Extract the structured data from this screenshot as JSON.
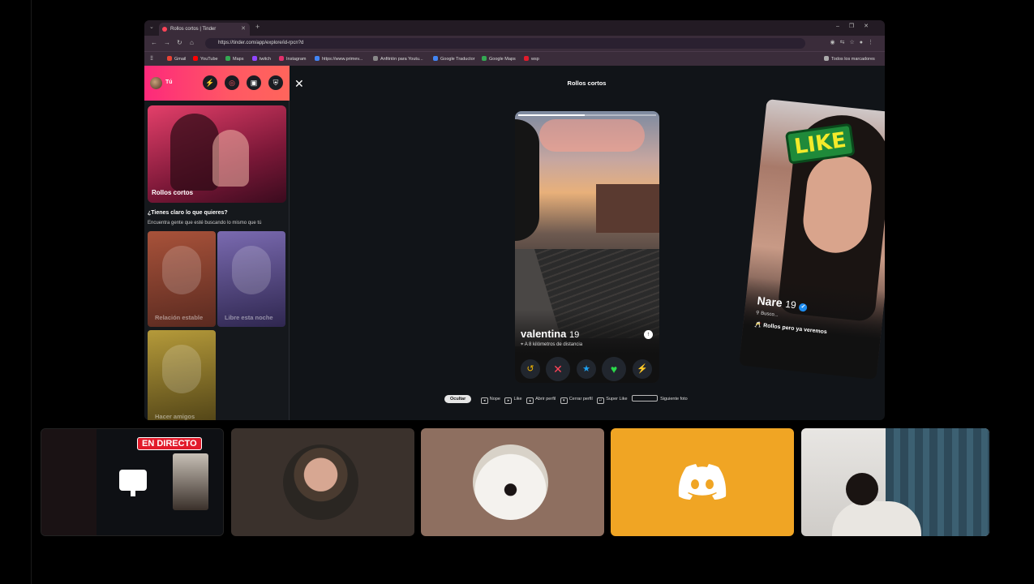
{
  "browser": {
    "tab_title": "Rollos cortos | Tinder",
    "url": "https://tinder.com/app/explore/id-rpcn?d",
    "url_prefix": "https://",
    "bookmarks": [
      "Gmail",
      "YouTube",
      "Maps",
      "twitch",
      "Instagram",
      "https://www.primev...",
      "Anfitrión para Youtu...",
      "Google Traductor",
      "Google Maps",
      "wsp"
    ],
    "all_bookmarks": "Todos los marcadores"
  },
  "sidebar": {
    "user_name": "Tú",
    "featured_card": "Rollos cortos",
    "question": "¿Tienes claro lo que quieres?",
    "question_sub": "Encuentra gente que esté buscando lo mismo que tú",
    "cards": [
      "Relación estable",
      "Libre esta noche",
      "Hacer amigos"
    ]
  },
  "main": {
    "title": "Rollos cortos",
    "current_profile": {
      "name": "valentina",
      "age": "19",
      "distance": "A 8 kilómetros de distancia"
    },
    "next_profile": {
      "name": "Nare",
      "age": "19",
      "looking": "Busco...",
      "tag": "Rollos pero ya veremos",
      "badge": "LIKE"
    },
    "hints": {
      "hide": "Ocultar",
      "nope": "Nope",
      "like": "Like",
      "open": "Abrir perfil",
      "close": "Cerrar perfil",
      "superlike": "Super Like",
      "next_photo": "Siguiente foto"
    }
  },
  "participants": {
    "live_badge": "EN DIRECTO"
  },
  "colors": {
    "tinder_pink": "#fd297b",
    "tinder_orange": "#ff655b",
    "discord_yellow": "#f0a524",
    "live_red": "#e21b2b"
  }
}
